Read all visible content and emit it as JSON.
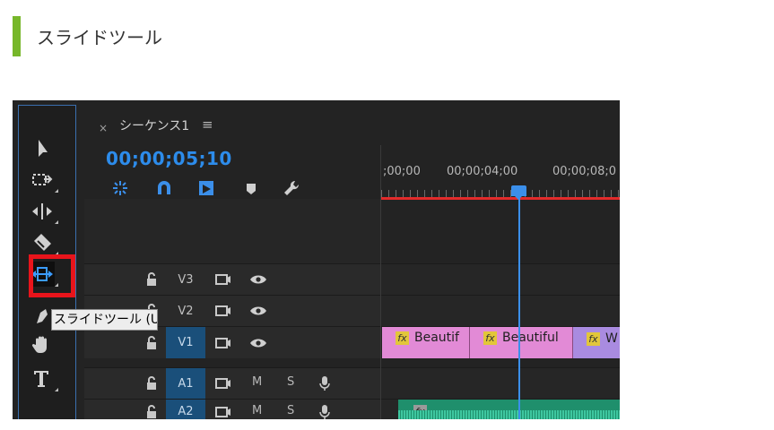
{
  "heading": {
    "title": "スライドツール",
    "accent_color": "#77b72a"
  },
  "tools": [
    {
      "name": "selection-tool",
      "icon": "arrow-icon"
    },
    {
      "name": "track-select-tool",
      "icon": "track-select-icon"
    },
    {
      "name": "ripple-edit-tool",
      "icon": "ripple-edit-icon"
    },
    {
      "name": "razor-tool",
      "icon": "razor-icon"
    },
    {
      "name": "slide-tool",
      "icon": "slide-icon",
      "selected": true
    },
    {
      "name": "pen-tool",
      "icon": "pen-icon"
    },
    {
      "name": "hand-tool",
      "icon": "hand-icon"
    },
    {
      "name": "type-tool",
      "icon": "type-icon"
    }
  ],
  "tooltip": {
    "text": "スライドツール (U)"
  },
  "sequence": {
    "close_glyph": "×",
    "tab_title": "シーケンス1",
    "menu_glyph": "≡",
    "timecode": "00;00;05;10",
    "ruler": [
      ";00;00",
      "00;00;04;00",
      "00;00;08;0"
    ],
    "accent_color": "#2d8ceb"
  },
  "tracks": {
    "video": [
      {
        "name": "V3",
        "active": false
      },
      {
        "name": "V2",
        "active": false
      },
      {
        "name": "V1",
        "active": true
      }
    ],
    "audio": [
      {
        "name": "A1",
        "active": true,
        "m": "M",
        "s": "S"
      },
      {
        "name": "A2",
        "active": true,
        "m": "M",
        "s": "S"
      }
    ]
  },
  "clips": {
    "v1": [
      {
        "label": "Beautif",
        "fx": "fx",
        "color": "#e28ad6"
      },
      {
        "label": "Beautiful",
        "fx": "fx",
        "color": "#e28ad6"
      },
      {
        "label": "W",
        "fx": "fx",
        "color": "#a98be0"
      }
    ],
    "a2_fx": "fx"
  }
}
